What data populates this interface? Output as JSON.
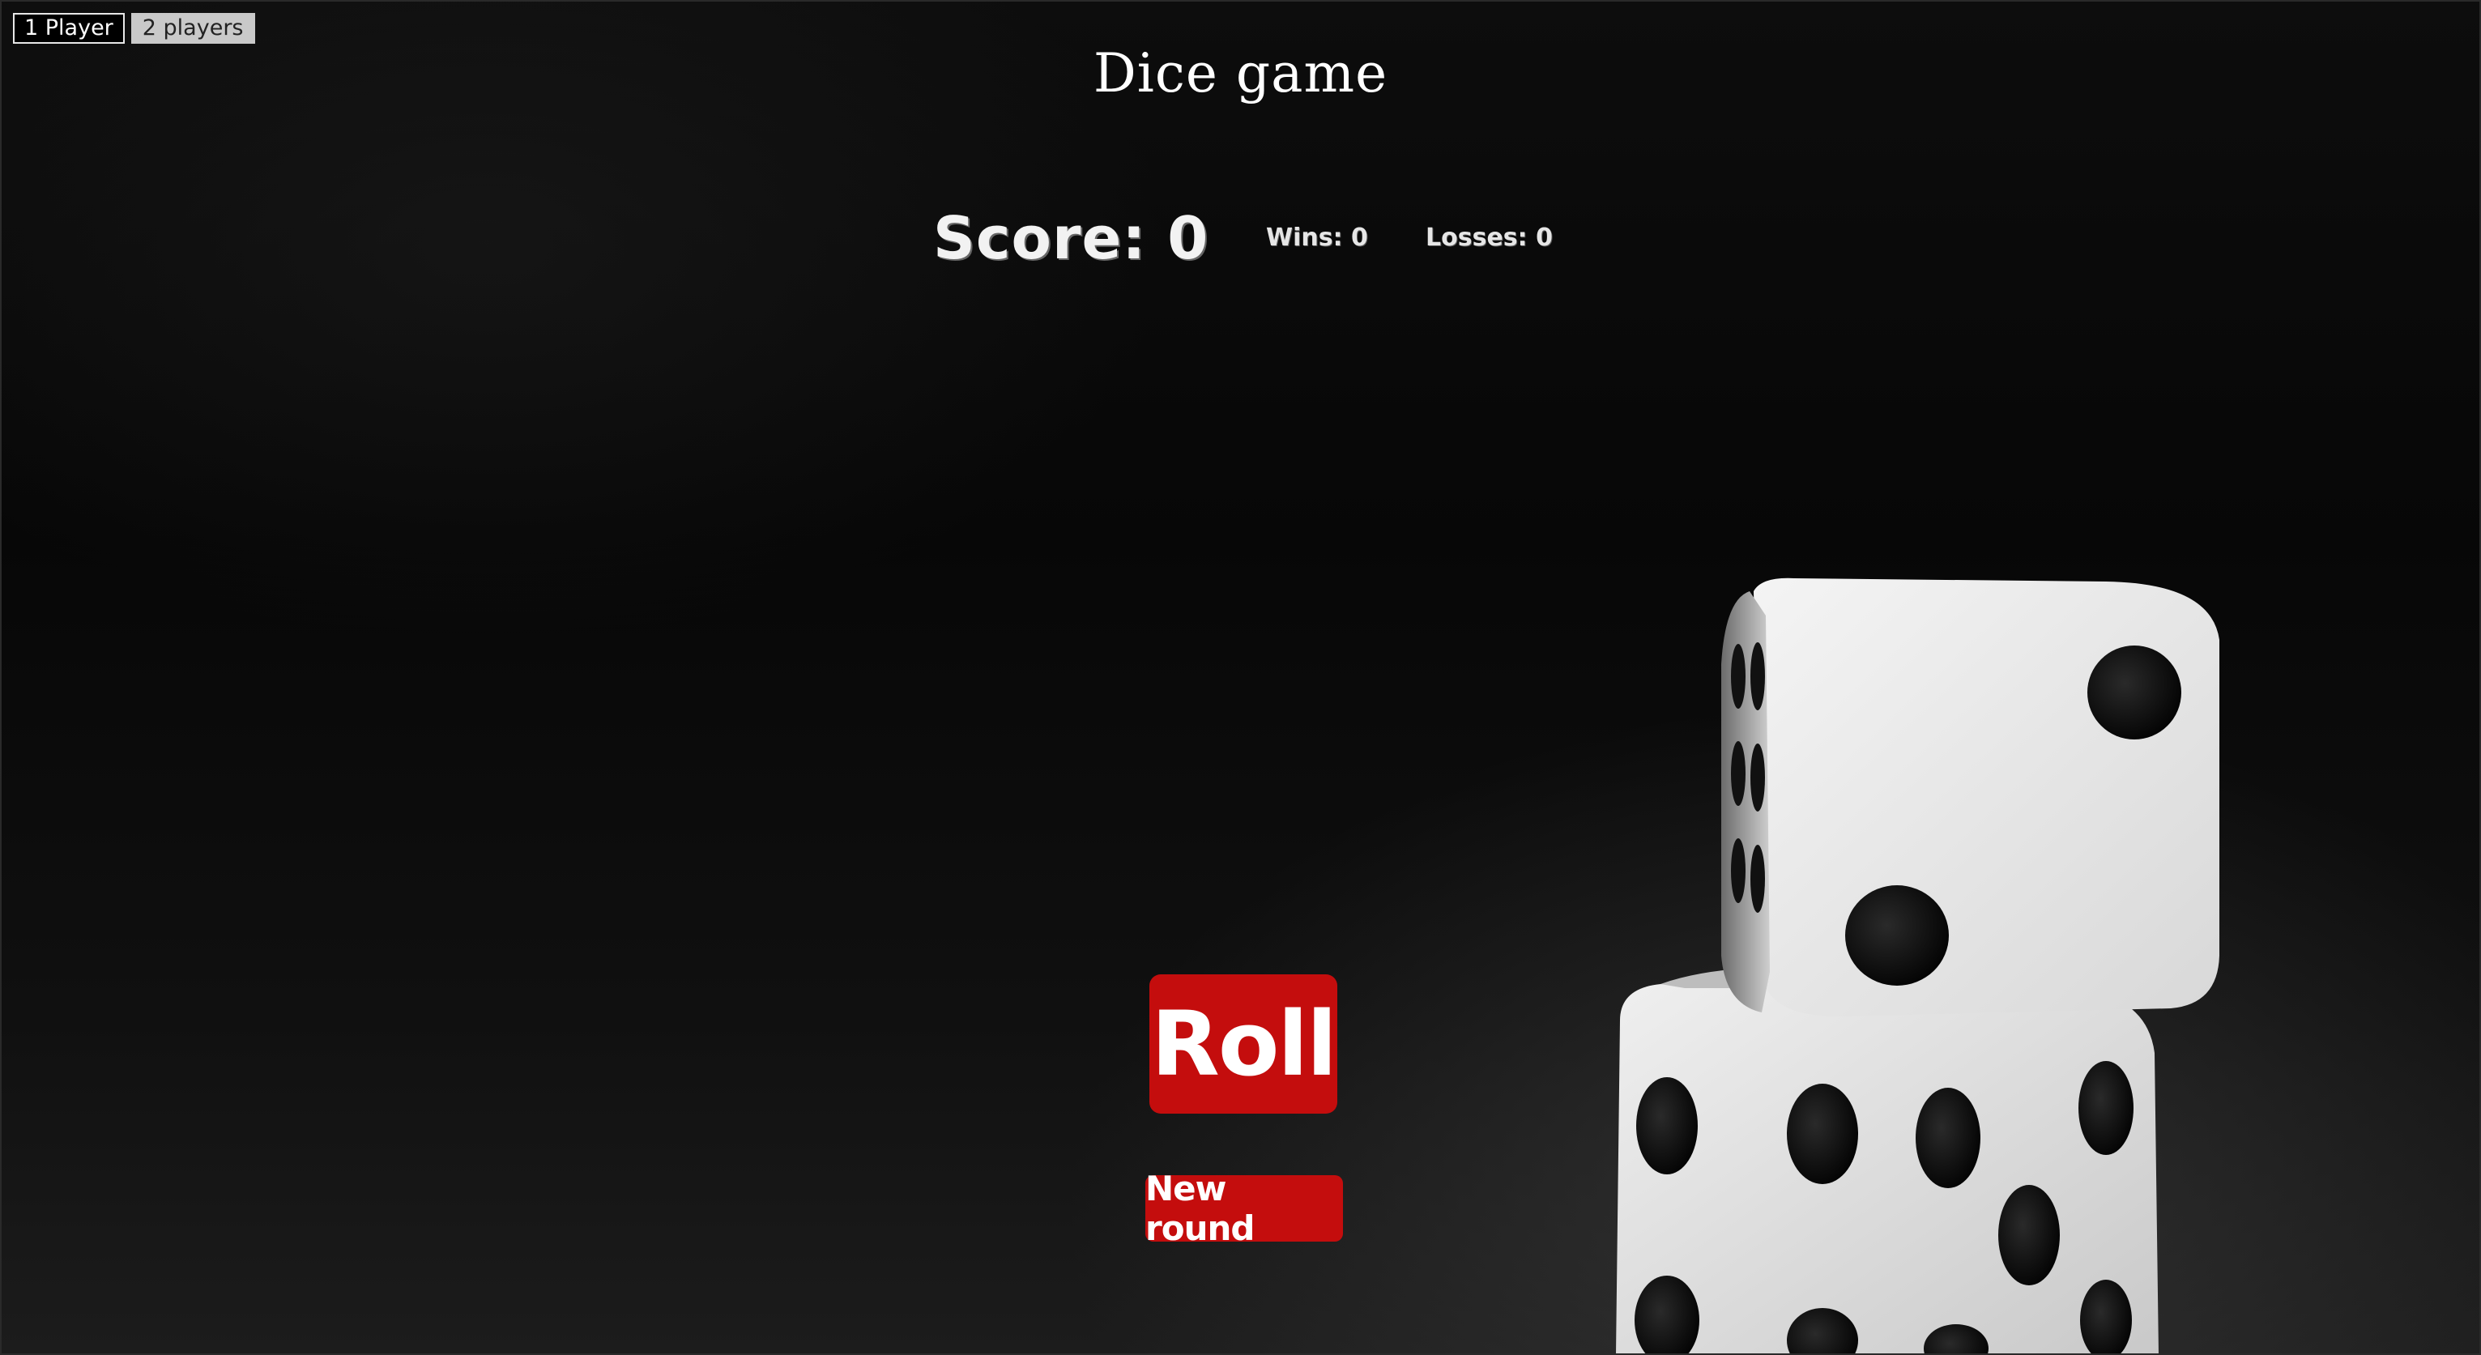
{
  "mode_selector": {
    "one_player_label": "1 Player",
    "two_players_label": "2 players",
    "selected": "1 Player"
  },
  "title": "Dice game",
  "scoreboard": {
    "score_label": "Score: 0",
    "wins_label": "Wins: 0",
    "losses_label": "Losses: 0"
  },
  "actions": {
    "roll_label": "Roll",
    "new_round_label": "New round"
  },
  "colors": {
    "button_red": "#c40d0d",
    "background": "#000000",
    "text": "#ffffff"
  },
  "background_image": {
    "icon": "dice-icon",
    "top_die_face": 2,
    "bottom_die_face": 5
  }
}
